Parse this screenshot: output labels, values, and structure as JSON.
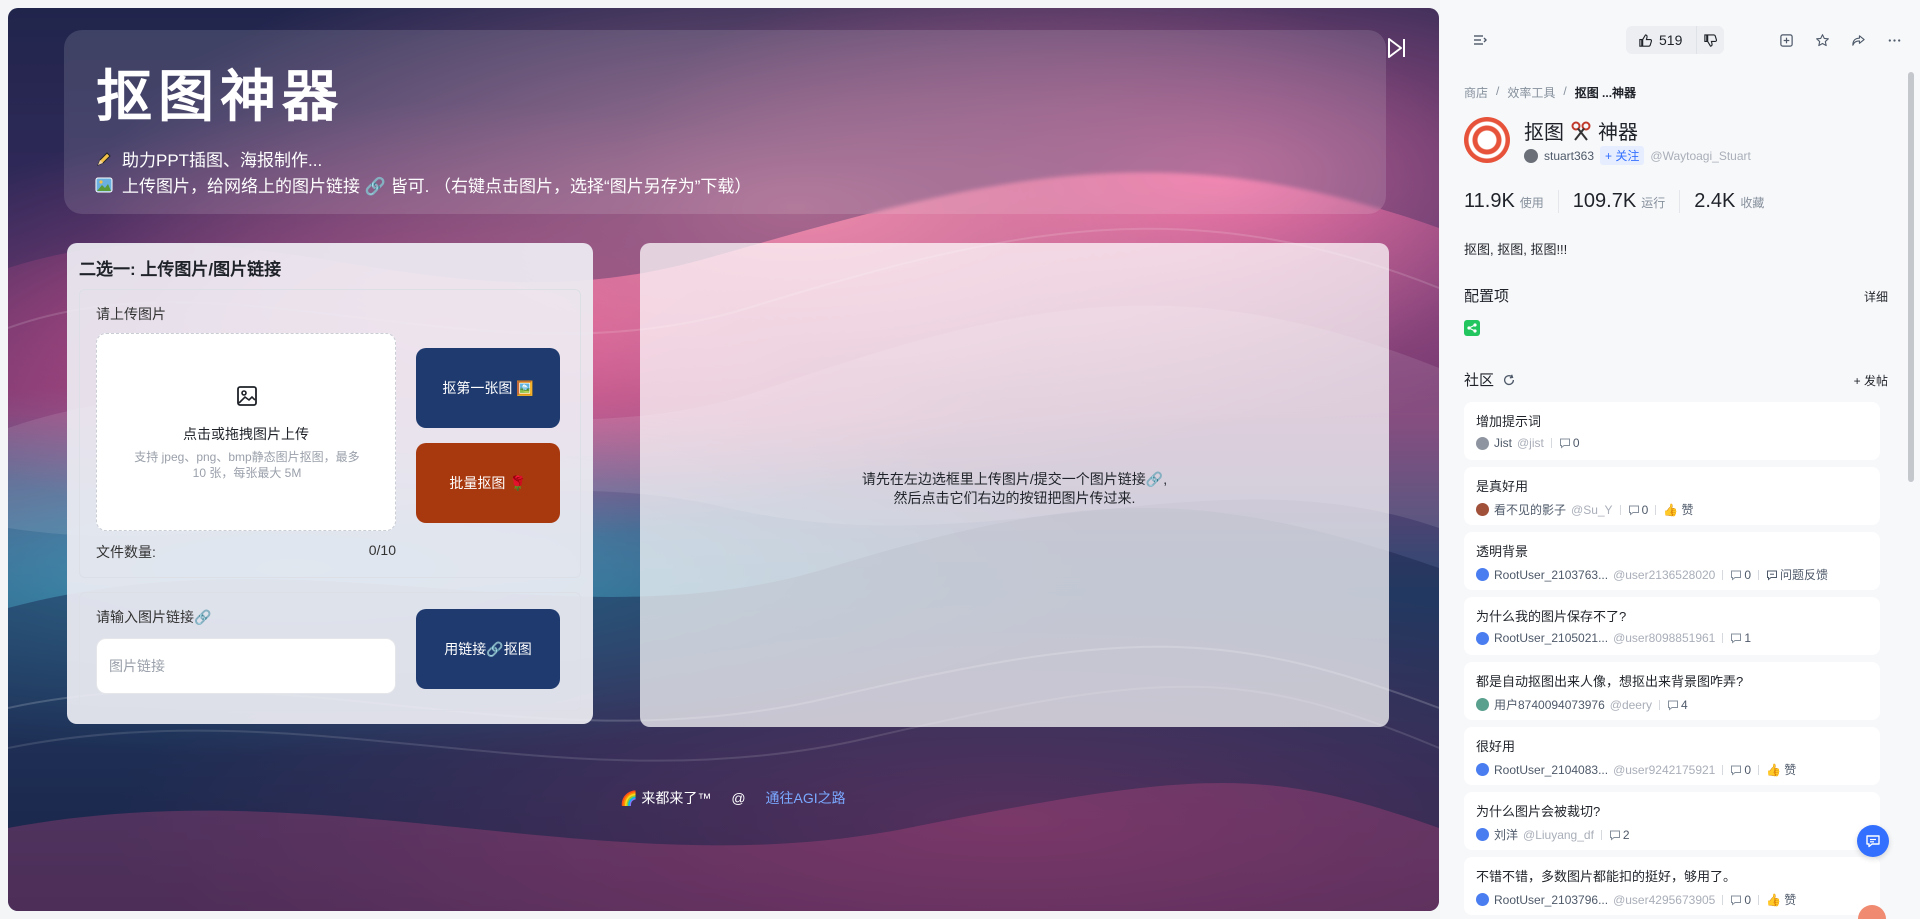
{
  "canvas": {
    "title": "抠图神器",
    "line1_text": "助力PPT插图、海报制作...",
    "line2_text": "上传图片，给网络上的图片链接 🔗 皆可. （右键点击图片，选择“图片另存为”下载）",
    "line1_icon": "pencil-emoji",
    "line2_icon": "picture-emoji"
  },
  "left_card": {
    "heading": "二选一: 上传图片/图片链接",
    "upload_label": "请上传图片",
    "upload_title": "点击或拖拽图片上传",
    "upload_hint": "支持 jpeg、png、bmp静态图片抠图，最多 10 张，每张最大 5M",
    "file_count_label": "文件数量:",
    "file_count_value": "0/10",
    "btn_first": "抠第一张图 🖼️",
    "btn_batch": "批量抠图 🌹",
    "url_label": "请输入图片链接🔗",
    "url_placeholder": "图片链接",
    "btn_url": "用链接🔗抠图"
  },
  "right_card": {
    "message_line1": "请先在左边选框里上传图片/提交一个图片链接🔗,",
    "message_line2": "然后点击它们右边的按钮把图片传过来."
  },
  "footer": {
    "text": "🌈 来都来了™",
    "at": "@",
    "link": "通往AGI之路"
  },
  "panel": {
    "like_count": "519",
    "breadcrumb": [
      "商店",
      "效率工具",
      "抠图 ...神器"
    ],
    "tool_name_a": "抠图",
    "tool_name_b": "神器",
    "author": "stuart363",
    "follow_label": "+ 关注",
    "author_handle": "@Waytoagi_Stuart",
    "stats": [
      {
        "num": "11.9K",
        "label": "使用"
      },
      {
        "num": "109.7K",
        "label": "运行"
      },
      {
        "num": "2.4K",
        "label": "收藏"
      }
    ],
    "description": "抠图, 抠图, 抠图!!!",
    "config_title": "配置项",
    "config_action": "详细",
    "community_title": "社区",
    "community_action": "+ 发帖",
    "posts": [
      {
        "title": "增加提示词",
        "user": "Jist",
        "handle": "@jist",
        "comments": "0",
        "extra": ""
      },
      {
        "title": "是真好用",
        "user": "看不见的影子",
        "handle": "@Su_Y",
        "comments": "0",
        "extra": "👍 赞"
      },
      {
        "title": "透明背景",
        "user": "RootUser_2103763...",
        "handle": "@user2136528020",
        "comments": "0",
        "extra": "问题反馈"
      },
      {
        "title": "为什么我的图片保存不了?",
        "user": "RootUser_2105021...",
        "handle": "@user8098851961",
        "comments": "1",
        "extra": ""
      },
      {
        "title": "都是自动抠图出来人像，想抠出来背景图咋弄?",
        "user": "用户8740094073976",
        "handle": "@deery",
        "comments": "4",
        "extra": ""
      },
      {
        "title": "很好用",
        "user": "RootUser_2104083...",
        "handle": "@user9242175921",
        "comments": "0",
        "extra": "👍 赞"
      },
      {
        "title": "为什么图片会被裁切?",
        "user": "刘洋",
        "handle": "@Liuyang_df",
        "comments": "2",
        "extra": ""
      },
      {
        "title": "不错不错，多数图片都能扣的挺好，够用了。",
        "user": "RootUser_2103796...",
        "handle": "@user4295673905",
        "comments": "0",
        "extra": "👍 赞"
      }
    ]
  }
}
